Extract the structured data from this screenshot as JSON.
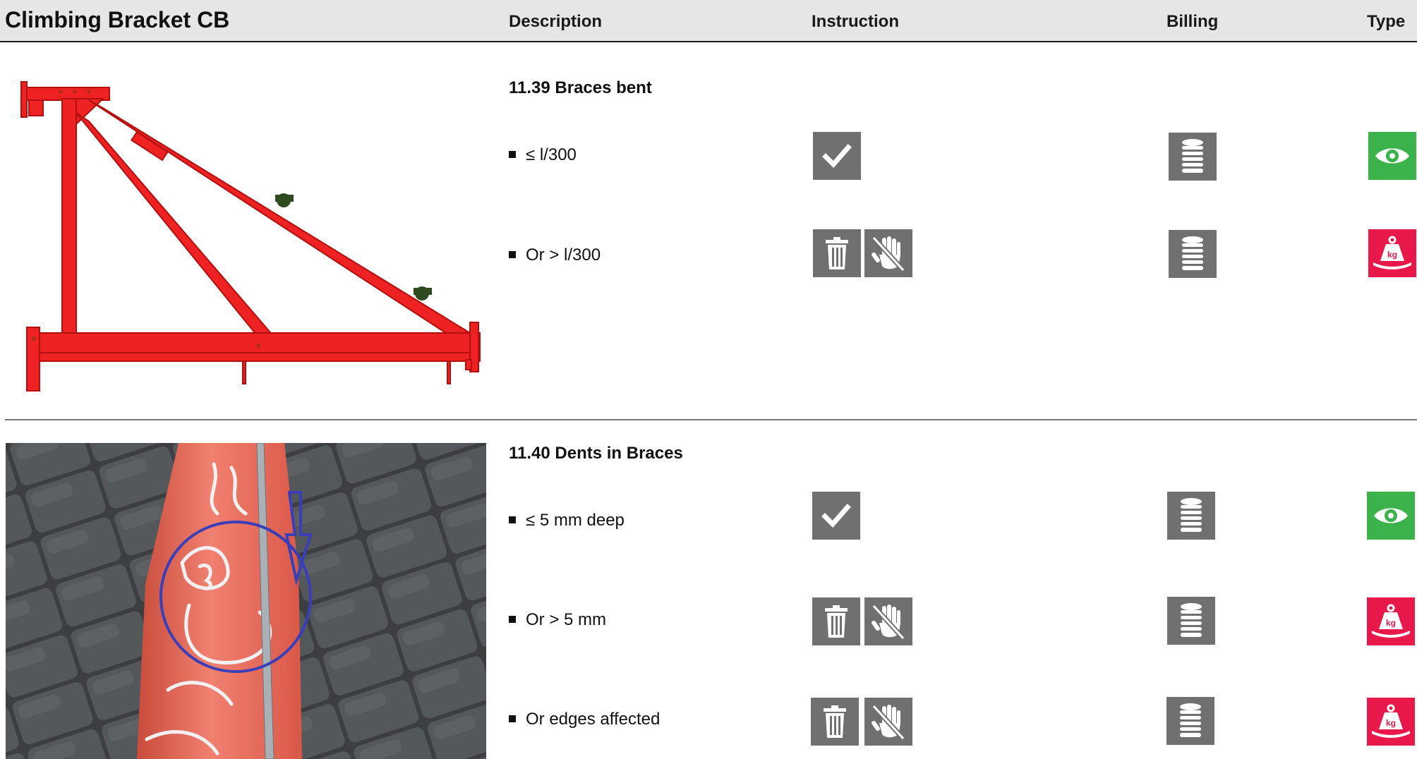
{
  "header": {
    "title": "Climbing Bracket CB",
    "columns": {
      "description": "Description",
      "instruction": "Instruction",
      "billing": "Billing",
      "type": "Type"
    }
  },
  "sections": [
    {
      "title": "11.39 Braces bent",
      "rows": [
        {
          "label": "≤ l/300",
          "instruction": [
            "check-icon"
          ],
          "billing": "coin-stack-icon",
          "type": "eye-icon"
        },
        {
          "label": "Or > l/300",
          "instruction": [
            "trash-icon",
            "no-touch-icon"
          ],
          "billing": "coin-stack-icon",
          "type": "weight-kg-icon"
        }
      ]
    },
    {
      "title": "11.40 Dents in Braces",
      "rows": [
        {
          "label": "≤ 5 mm deep",
          "instruction": [
            "check-icon"
          ],
          "billing": "coin-stack-icon",
          "type": "eye-icon"
        },
        {
          "label": "Or > 5 mm",
          "instruction": [
            "trash-icon",
            "no-touch-icon"
          ],
          "billing": "coin-stack-icon",
          "type": "weight-kg-icon"
        },
        {
          "label": "Or edges affected",
          "instruction": [
            "trash-icon",
            "no-touch-icon"
          ],
          "billing": "coin-stack-icon",
          "type": "weight-kg-icon"
        }
      ]
    }
  ],
  "colors": {
    "header_bg": "#e6e6e6",
    "icon_gray": "#707070",
    "type_ok_green": "#3bb34a",
    "type_scrap_red": "#e8194a",
    "bracket_red": "#ee2222"
  }
}
